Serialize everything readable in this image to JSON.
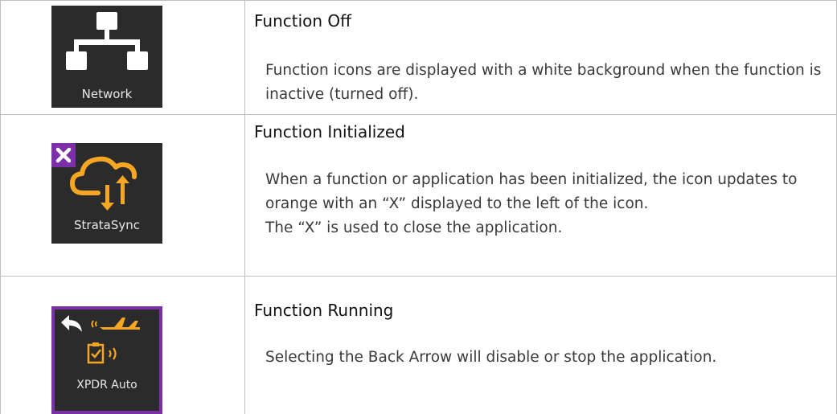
{
  "rows": [
    {
      "icon_label": "Network",
      "icon": "network-icon",
      "title": "Function Off",
      "body": "Function icons are displayed with a white background when the function is inactive (turned off)."
    },
    {
      "icon_label": "StrataSync",
      "icon": "cloud-sync-icon",
      "title": "Function Initialized",
      "body_lines": [
        "When a function or application has been initialized, the icon updates to orange with an “X” displayed to the left of the icon.",
        "The “X” is used to close the application."
      ]
    },
    {
      "icon_label": "XPDR Auto",
      "icon": "transponder-icon",
      "title": "Function Running",
      "body": "Selecting the Back Arrow will disable or stop the application."
    }
  ],
  "colors": {
    "tile_bg": "#2b2b2b",
    "accent_orange": "#f5a623",
    "accent_purple": "#7b2fa8",
    "icon_white": "#ffffff"
  }
}
